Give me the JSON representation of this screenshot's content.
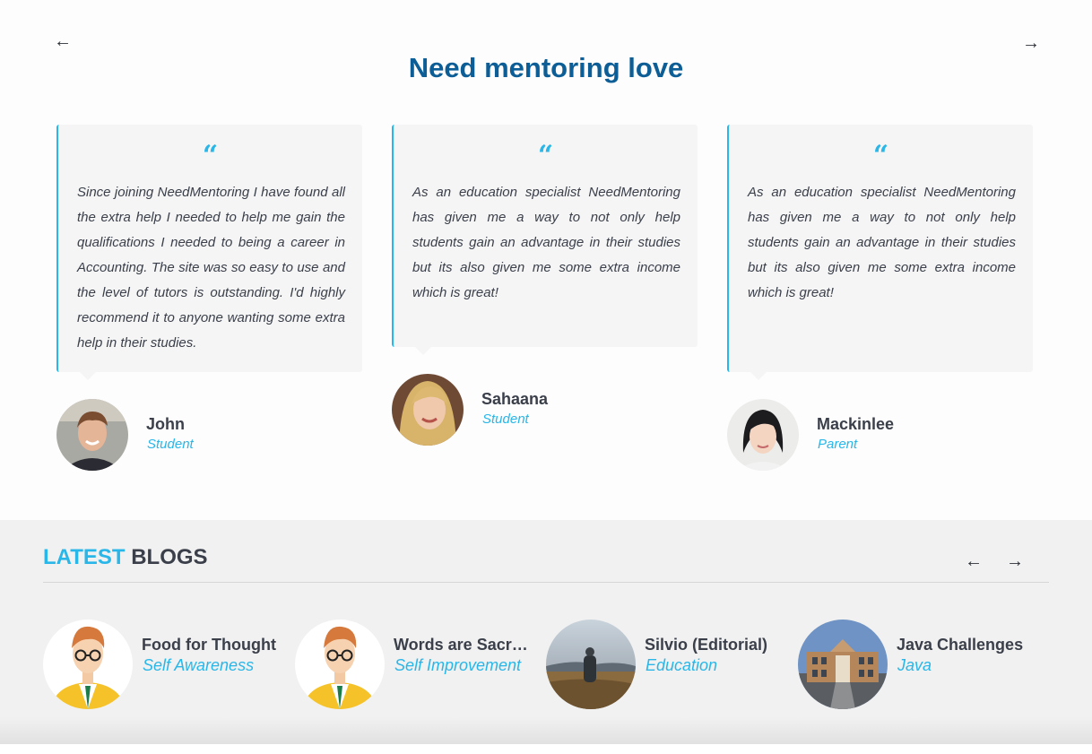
{
  "testimonials": {
    "title": "Need mentoring love",
    "prev_icon": "arrow-left-icon",
    "next_icon": "arrow-right-icon",
    "items": [
      {
        "quote_mark": "“",
        "text": "Since joining NeedMentoring I have found all the extra  help I needed to help me gain the qualifications I needed to being  a career in Accounting. The site was  so easy to use and the level of tutors is outstanding. I'd highly recommend it to anyone wanting some extra help in their studies.",
        "name": "John",
        "role": "Student"
      },
      {
        "quote_mark": "“",
        "text": "As an education specialist NeedMentoring has given me a way to not only help students gain an advantage in their studies  but its also given me some extra income which is great!",
        "name": "Sahaana",
        "role": "Student"
      },
      {
        "quote_mark": "“",
        "text": "As an education specialist NeedMentoring has given me a way to not only help students gain an advantage in their studies  but its also given me some extra income which is great!",
        "name": "Mackinlee",
        "role": "Parent"
      }
    ]
  },
  "blogs": {
    "title_accent": "LATEST",
    "title_rest": "BLOGS",
    "items": [
      {
        "title": "Food for Thought",
        "category": "Self Awareness"
      },
      {
        "title": "Words are Sacred",
        "category": "Self Improvement"
      },
      {
        "title": "Silvio (Editorial)",
        "category": "Education"
      },
      {
        "title": "Java Challenges",
        "category": "Java"
      }
    ]
  },
  "colors": {
    "accent": "#29b6e8",
    "title_blue": "#0d5e96",
    "text_dark": "#3a3f4a"
  }
}
